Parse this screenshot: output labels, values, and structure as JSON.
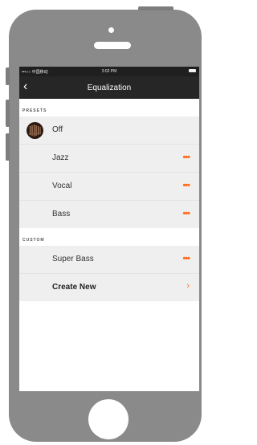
{
  "status_bar": {
    "carrier": "•••○○ 中国移动 ",
    "time": "3:02 PM"
  },
  "navbar": {
    "back_icon": "chevron-left-icon",
    "title": "Equalization"
  },
  "presets": {
    "header": "PRESETS",
    "items": [
      {
        "label": "Off",
        "icon": "eq-avatar-icon"
      },
      {
        "label": "Jazz",
        "icon": "more-dots-icon"
      },
      {
        "label": "Vocal",
        "icon": "more-dots-icon"
      },
      {
        "label": "Bass",
        "icon": "more-dots-icon"
      }
    ]
  },
  "custom": {
    "header": "CUSTOM",
    "items": [
      {
        "label": "Super Bass",
        "icon": "more-dots-icon"
      },
      {
        "label": "Create New",
        "icon": "chevron-right-icon"
      }
    ]
  },
  "colors": {
    "accent": "#ff6a1a",
    "navbar": "#262626",
    "row_bg": "#efefef",
    "phone_body": "#8a8a8a"
  },
  "glyphs": {
    "more": "•••",
    "chevron_right": "›",
    "chevron_left": "‹"
  }
}
